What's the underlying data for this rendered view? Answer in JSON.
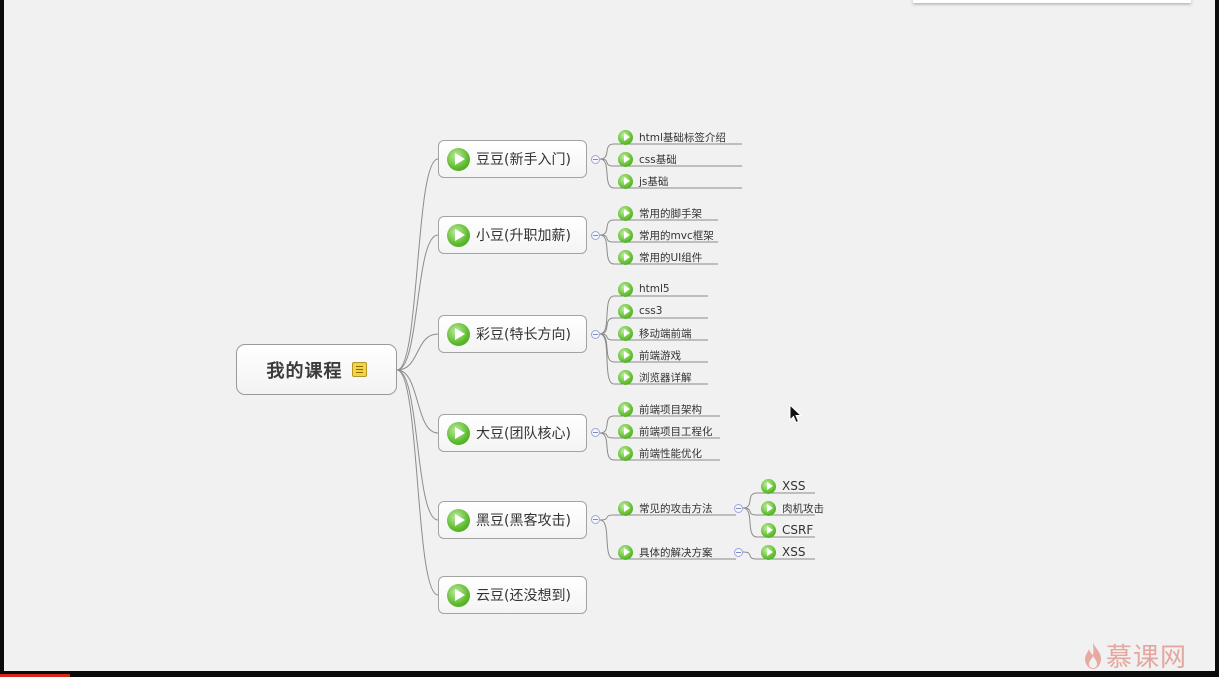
{
  "mindmap": {
    "root": {
      "label": "我的课程",
      "icon": "note-icon"
    },
    "branches": [
      {
        "label": "豆豆(新手入门)",
        "children": [
          "html基础标签介绍",
          "css基础",
          "js基础"
        ]
      },
      {
        "label": "小豆(升职加薪)",
        "children": [
          "常用的脚手架",
          "常用的mvc框架",
          "常用的UI组件"
        ]
      },
      {
        "label": "彩豆(特长方向)",
        "children": [
          "html5",
          "css3",
          "移动端前端",
          "前端游戏",
          "浏览器详解"
        ]
      },
      {
        "label": "大豆(团队核心)",
        "children": [
          "前端项目架构",
          "前端项目工程化",
          "前端性能优化"
        ]
      },
      {
        "label": "黑豆(黑客攻击)",
        "children": [
          {
            "label": "常见的攻击方法",
            "children": [
              "XSS",
              "肉机攻击",
              "CSRF"
            ]
          },
          {
            "label": "具体的解决方案",
            "children": [
              "XSS"
            ]
          }
        ]
      },
      {
        "label": "云豆(还没想到)",
        "children": []
      }
    ]
  },
  "watermark": {
    "text": "慕课网",
    "icon": "flame-icon"
  },
  "colors": {
    "node_green": "#5cba2c",
    "line": "#8c8c8c",
    "collapse": "#9aa7d8"
  }
}
